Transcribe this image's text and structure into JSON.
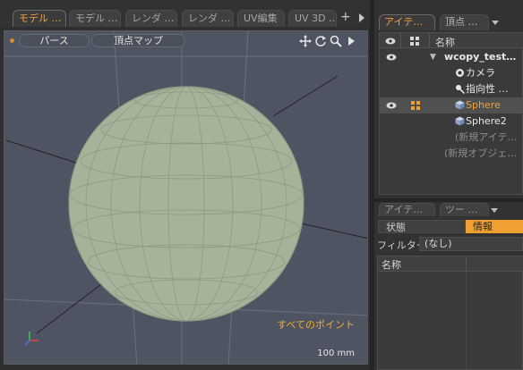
{
  "viewport_tabs": [
    {
      "label": "モデル …",
      "active": true
    },
    {
      "label": "モデル …",
      "active": false
    },
    {
      "label": "レンダ …",
      "active": false
    },
    {
      "label": "レンダ …",
      "active": false
    },
    {
      "label": "UV編集",
      "active": false
    },
    {
      "label": "UV 3D …",
      "active": false
    }
  ],
  "viewport_tab_plus": "+",
  "viewport": {
    "view_mode": "パース",
    "selection_mode": "頂点マップ",
    "points_label": "すべてのポイント",
    "scale_label": "100 mm",
    "icons": [
      "move-view-icon",
      "rotate-view-icon",
      "zoom-view-icon",
      "play-menu-icon"
    ]
  },
  "items_panel": {
    "tabs": [
      {
        "label": "アイテ…",
        "active": true
      },
      {
        "label": "頂点 …",
        "active": false
      }
    ],
    "column_header": "名称",
    "rows": [
      {
        "label": "wcopy_test…",
        "kind": "scene"
      },
      {
        "label": "カメラ",
        "kind": "camera"
      },
      {
        "label": "指向性 …",
        "kind": "light"
      },
      {
        "label": "Sphere",
        "kind": "mesh",
        "selected": true
      },
      {
        "label": "Sphere2",
        "kind": "mesh"
      },
      {
        "label": "(新規アイテ…",
        "kind": "placeholder"
      },
      {
        "label": "(新規オブジェ…",
        "kind": "placeholder"
      }
    ]
  },
  "properties_panel": {
    "tabs": [
      {
        "label": "アイテ…"
      },
      {
        "label": "ツー …"
      }
    ],
    "segment_left": "状態",
    "segment_right": "情報",
    "filter_label": "フィルター",
    "filter_value": "(なし)",
    "column_header": "名称"
  },
  "colors": {
    "accent": "#f0a030",
    "viewport_bg": "#4e5461",
    "sphere_fill": "#a4b39a"
  }
}
